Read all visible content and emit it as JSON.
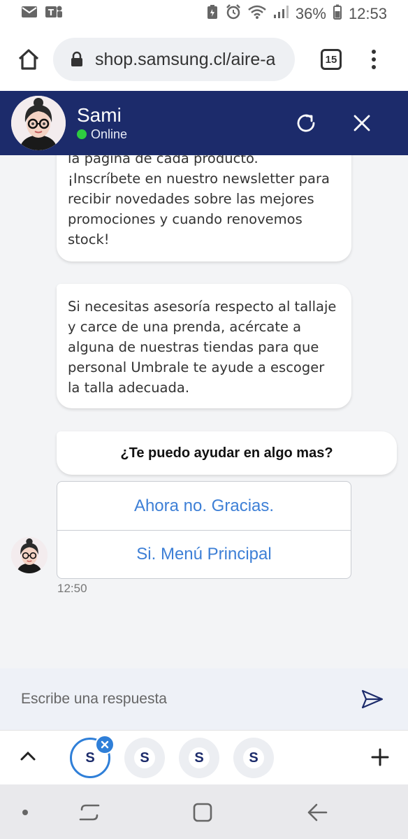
{
  "status_bar": {
    "battery": "36%",
    "time": "12:53",
    "icons": [
      "mail-icon",
      "teams-icon",
      "battery-saver-icon",
      "alarm-icon",
      "wifi-icon",
      "signal-icon",
      "battery-icon"
    ]
  },
  "browser": {
    "url": "shop.samsung.cl/aire-a",
    "tab_count": "15"
  },
  "chat_header": {
    "name": "Sami",
    "status": "Online",
    "status_color": "#2ecc40",
    "background": "#1c2b6b"
  },
  "messages": [
    {
      "lines": [
        "la página de cada producto.",
        "¡Inscríbete en nuestro newsletter para",
        "recibir novedades sobre las mejores",
        "promociones y cuando renovemos",
        "stock!"
      ]
    },
    {
      "lines": [
        "Si necesitas asesoría respecto al tallaje",
        "y carce de una prenda, acércate a",
        "alguna de nuestras tiendas para que",
        "personal Umbrale te ayude a escoger",
        "la talla adecuada."
      ]
    }
  ],
  "question": "¿Te puedo ayudar en algo mas?",
  "options": [
    "Ahora no. Gracias.",
    "Si. Menú Principal"
  ],
  "timestamp": "12:50",
  "input": {
    "placeholder": "Escribe una respuesta"
  },
  "tab_strip": {
    "tabs": [
      "S",
      "S",
      "S",
      "S"
    ],
    "active_color": "#2f7fd8"
  }
}
